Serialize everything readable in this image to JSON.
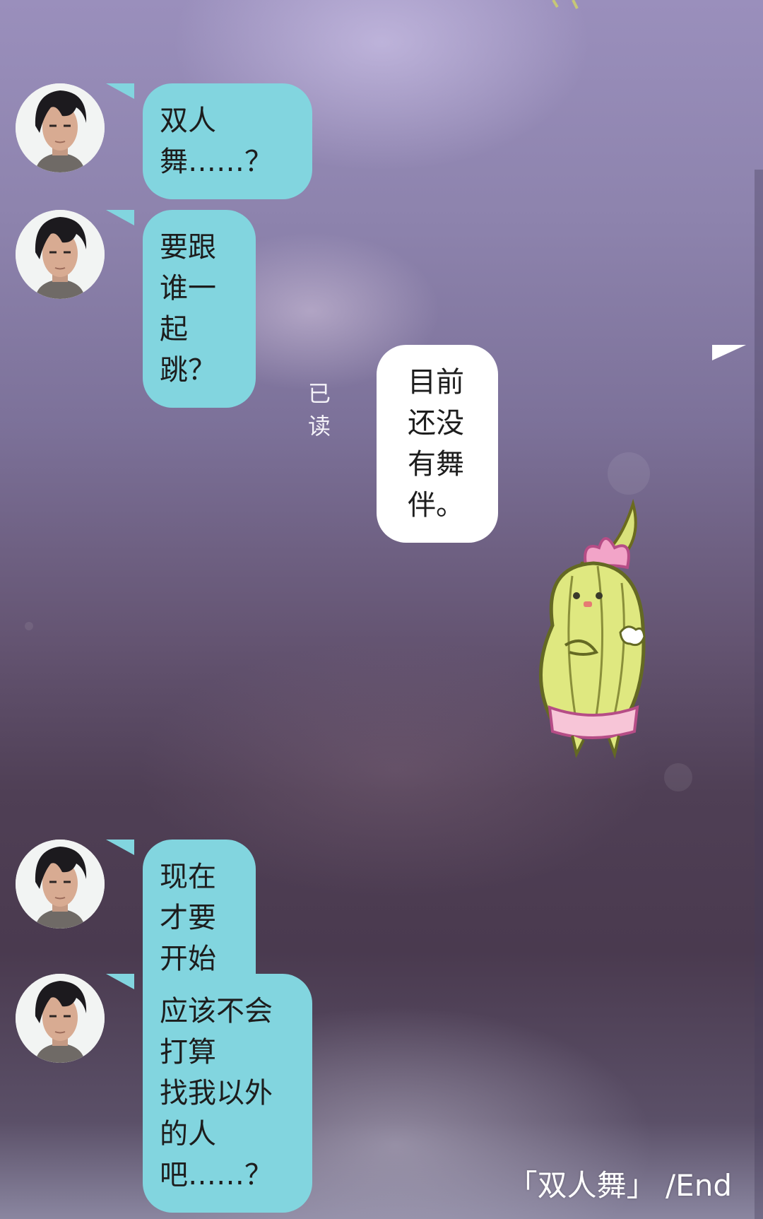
{
  "conversation": {
    "messages": [
      {
        "sender": "contact",
        "text": "双人舞……？"
      },
      {
        "sender": "contact",
        "text": "要跟谁一起跳？"
      },
      {
        "sender": "me",
        "text": "目前还没有舞伴。",
        "status": "已读"
      },
      {
        "sender": "me",
        "type": "sticker",
        "icon": "cactus-character-sticker"
      },
      {
        "sender": "contact",
        "text": "现在才要开始找？"
      },
      {
        "sender": "contact",
        "text": "应该不会打算\n找我以外的人吧……？"
      }
    ]
  },
  "footer": {
    "caption": "「双人舞」 /End"
  },
  "colors": {
    "incoming_bubble": "#82d5df",
    "outgoing_bubble": "#ffffff"
  }
}
